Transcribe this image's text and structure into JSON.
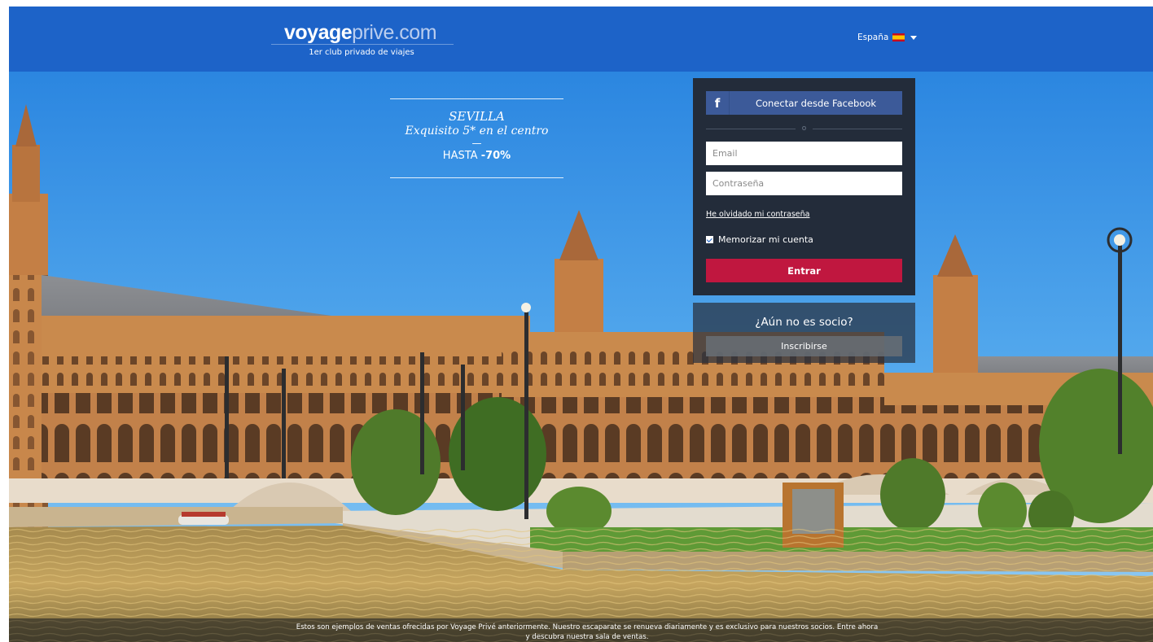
{
  "header": {
    "logo_bold": "voyage",
    "logo_light": "prive.com",
    "tagline": "1er club privado de viajes",
    "country": "España"
  },
  "promo": {
    "city": "SEVILLA",
    "subtitle": "Exquisito 5* en el centro",
    "dash": "—",
    "offer_prefix": "HASTA",
    "offer_value": "-70%"
  },
  "login": {
    "facebook_icon": "f",
    "facebook_label": "Conectar desde Facebook",
    "or_text": "o",
    "email_placeholder": "Email",
    "password_placeholder": "Contraseña",
    "forgot_link": "He olvidado mi contraseña",
    "remember_label": "Memorizar mi cuenta",
    "remember_checked": true,
    "submit_label": "Entrar"
  },
  "signup": {
    "question": "¿Aún no es socio?",
    "button_label": "Inscribirse"
  },
  "footer": {
    "disclaimer_line1": "Estos son ejemplos de ventas ofrecidas por Voyage Privé anteriormente. Nuestro escaparate se renueva diariamente y es exclusivo para nuestros socios. Entre ahora",
    "disclaimer_line2": "y descubra nuestra sala de ventas."
  },
  "colors": {
    "header_bg": "#1d63c8",
    "login_bg": "#232c3a",
    "facebook": "#3c5a99",
    "submit": "#c0173f",
    "sky": "#3a97e8",
    "building": "#c98a4d"
  },
  "icons": {
    "facebook": "facebook-icon",
    "flag": "spain-flag-icon",
    "caret": "chevron-down-icon",
    "checkbox": "checkmark-icon"
  }
}
